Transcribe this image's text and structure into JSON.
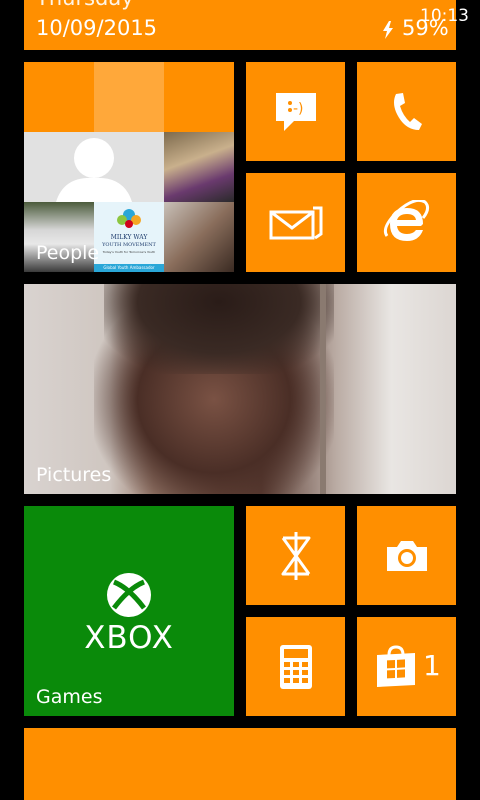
{
  "status": {
    "day": "Thursday",
    "date": "10/09/2015",
    "battery": "59%",
    "time": "10:13",
    "charging_icon": "lightning-icon"
  },
  "tiles": {
    "people": {
      "label": "People",
      "badge_line1": "MILKY WAY",
      "badge_line2": "YOUTH MOVEMENT",
      "badge_line3": "Today's Youth for Tomorrow's Youth",
      "badge_line4": "Global Youth Ambassador"
    },
    "messaging": {
      "icon": "message-smiley-icon"
    },
    "phone": {
      "icon": "phone-icon"
    },
    "email": {
      "icon": "mail-icon"
    },
    "browser": {
      "icon": "internet-explorer-icon"
    },
    "pictures": {
      "label": "Pictures"
    },
    "games": {
      "label": "Games",
      "logo_text": "XBOX"
    },
    "music": {
      "icon": "zune-music-icon"
    },
    "camera": {
      "icon": "camera-icon"
    },
    "calculator": {
      "icon": "calculator-icon"
    },
    "store": {
      "icon": "store-bag-icon",
      "count": "1"
    }
  },
  "colors": {
    "accent": "#FF8F00",
    "xbox": "#0A8A0A",
    "background": "#000000"
  }
}
